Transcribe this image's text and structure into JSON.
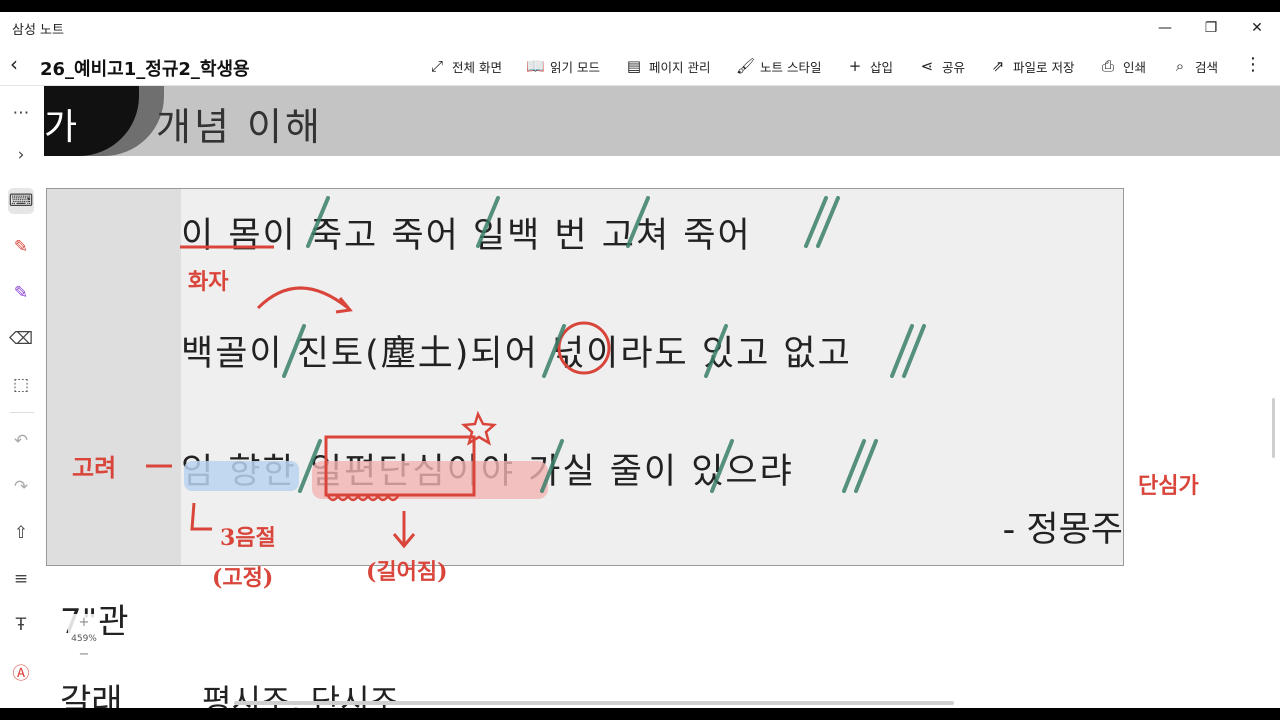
{
  "window": {
    "title": "삼성 노트",
    "minimize": "—",
    "maximize": "❐",
    "close": "✕"
  },
  "toolbar": {
    "back": "‹",
    "note_title": "26_예비고1_정규2_학생용",
    "items": [
      {
        "icon": "⤢",
        "label": "전체 화면"
      },
      {
        "icon": "📖",
        "label": "읽기 모드"
      },
      {
        "icon": "▤",
        "label": "페이지 관리"
      },
      {
        "icon": "🖌",
        "label": "노트 스타일"
      },
      {
        "icon": "+",
        "label": "삽입"
      },
      {
        "icon": "⋖",
        "label": "공유"
      },
      {
        "icon": "⇗",
        "label": "파일로 저장"
      },
      {
        "icon": "⎙",
        "label": "인쇄"
      },
      {
        "icon": "⌕",
        "label": "검색"
      }
    ],
    "more": "⋮"
  },
  "sidebar": {
    "items": [
      {
        "icon": "⋯"
      },
      {
        "icon": "›"
      },
      {
        "icon": "⌨"
      },
      {
        "icon": "✎"
      },
      {
        "icon": "✎"
      },
      {
        "icon": "⌫"
      },
      {
        "icon": "⬚"
      },
      {
        "icon": "↶"
      },
      {
        "icon": "↷"
      },
      {
        "icon": "⇧"
      },
      {
        "icon": "≡"
      },
      {
        "icon": "Ŧ"
      },
      {
        "icon": "Ⓐ"
      }
    ]
  },
  "note": {
    "badge": "가",
    "header": "개념 이해",
    "poem": {
      "line1": "이 몸이 죽고 죽어 일백 번 고쳐 죽어",
      "line2": "백골이 진토(塵土)되어 넋이라도 있고 없고",
      "line3": "임 향한 일편단심이야 가실 줄이 있으랴",
      "author": "- 정몽주"
    },
    "section_label": "7\"관",
    "bottom_label": "갈래",
    "bottom_text": "평시조, 단시조",
    "zoom": {
      "plus": "+",
      "level": "459%",
      "minus": "−"
    }
  },
  "annotations": {
    "speaker": "화자",
    "lord": "고려",
    "syllables": "3음절",
    "fixed": "(고정)",
    "lengthened": "(길어짐)",
    "genre": "단심가"
  },
  "colors": {
    "accent_red": "#d9453b",
    "slash_teal": "#3b7f6b",
    "highlight_blue": "#b9d3f0",
    "highlight_red": "#f4b4b4"
  }
}
